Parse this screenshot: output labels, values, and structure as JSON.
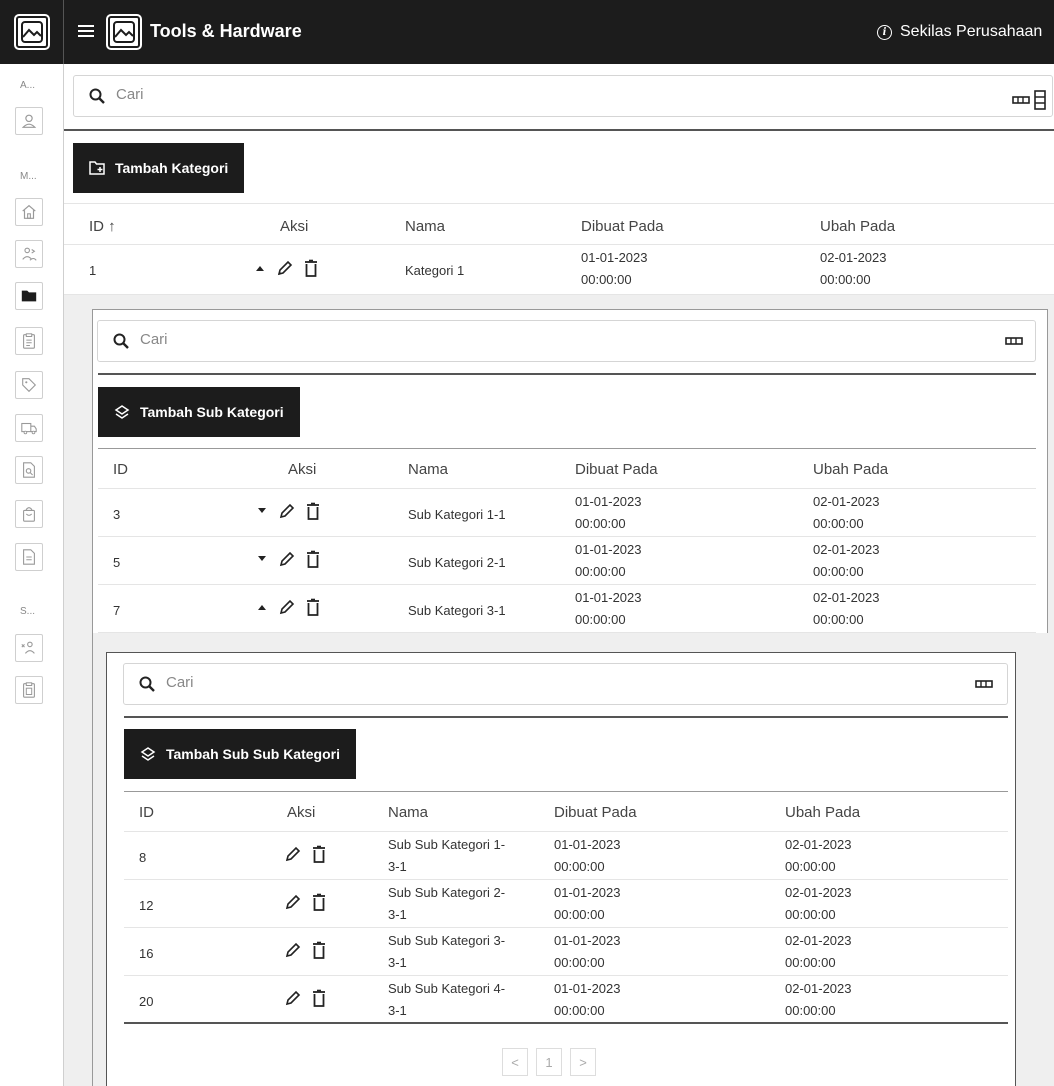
{
  "header": {
    "app_title": "Tools & Hardware",
    "info_label": "Sekilas Perusahaan"
  },
  "sidebar": {
    "sections": [
      "A...",
      "M...",
      "S..."
    ],
    "items": [
      {
        "icon": "user-icon"
      },
      {
        "icon": "home-icon"
      },
      {
        "icon": "users-icon"
      },
      {
        "icon": "folder-icon"
      },
      {
        "icon": "clipboard-icon"
      },
      {
        "icon": "tag-icon"
      },
      {
        "icon": "truck-icon"
      },
      {
        "icon": "search-document-icon"
      },
      {
        "icon": "shopping-bag-icon"
      },
      {
        "icon": "file-icon"
      },
      {
        "icon": "users-remove-icon"
      },
      {
        "icon": "clipboard-paste-icon"
      }
    ]
  },
  "level1": {
    "search_placeholder": "Cari",
    "add_button": "Tambah Kategori",
    "columns": [
      "ID ↑",
      "Aksi",
      "Nama",
      "Dibuat Pada",
      "Ubah Pada"
    ],
    "rows": [
      {
        "id": "1",
        "nama": "Kategori 1",
        "dibuat_date": "01-01-2023",
        "dibuat_time": "00:00:00",
        "ubah_date": "02-01-2023",
        "ubah_time": "00:00:00"
      }
    ]
  },
  "level2": {
    "search_placeholder": "Cari",
    "add_button": "Tambah Sub Kategori",
    "columns": [
      "ID",
      "Aksi",
      "Nama",
      "Dibuat Pada",
      "Ubah Pada"
    ],
    "rows": [
      {
        "id": "3",
        "nama": "Sub Kategori 1-1",
        "dibuat_date": "01-01-2023",
        "dibuat_time": "00:00:00",
        "ubah_date": "02-01-2023",
        "ubah_time": "00:00:00"
      },
      {
        "id": "5",
        "nama": "Sub Kategori 2-1",
        "dibuat_date": "01-01-2023",
        "dibuat_time": "00:00:00",
        "ubah_date": "02-01-2023",
        "ubah_time": "00:00:00"
      },
      {
        "id": "7",
        "nama": "Sub Kategori 3-1",
        "dibuat_date": "01-01-2023",
        "dibuat_time": "00:00:00",
        "ubah_date": "02-01-2023",
        "ubah_time": "00:00:00"
      }
    ]
  },
  "level3": {
    "search_placeholder": "Cari",
    "add_button": "Tambah Sub Sub Kategori",
    "columns": [
      "ID",
      "Aksi",
      "Nama",
      "Dibuat Pada",
      "Ubah Pada"
    ],
    "rows": [
      {
        "id": "8",
        "nama_a": "Sub Sub Kategori 1-",
        "nama_b": "3-1",
        "dibuat_date": "01-01-2023",
        "dibuat_time": "00:00:00",
        "ubah_date": "02-01-2023",
        "ubah_time": "00:00:00"
      },
      {
        "id": "12",
        "nama_a": "Sub Sub Kategori 2-",
        "nama_b": "3-1",
        "dibuat_date": "01-01-2023",
        "dibuat_time": "00:00:00",
        "ubah_date": "02-01-2023",
        "ubah_time": "00:00:00"
      },
      {
        "id": "16",
        "nama_a": "Sub Sub Kategori 3-",
        "nama_b": "3-1",
        "dibuat_date": "01-01-2023",
        "dibuat_time": "00:00:00",
        "ubah_date": "02-01-2023",
        "ubah_time": "00:00:00"
      },
      {
        "id": "20",
        "nama_a": "Sub Sub Kategori 4-",
        "nama_b": "3-1",
        "dibuat_date": "01-01-2023",
        "dibuat_time": "00:00:00",
        "ubah_date": "02-01-2023",
        "ubah_time": "00:00:00"
      }
    ],
    "pagination": {
      "prev": "<",
      "current": "1",
      "next": ">"
    }
  }
}
